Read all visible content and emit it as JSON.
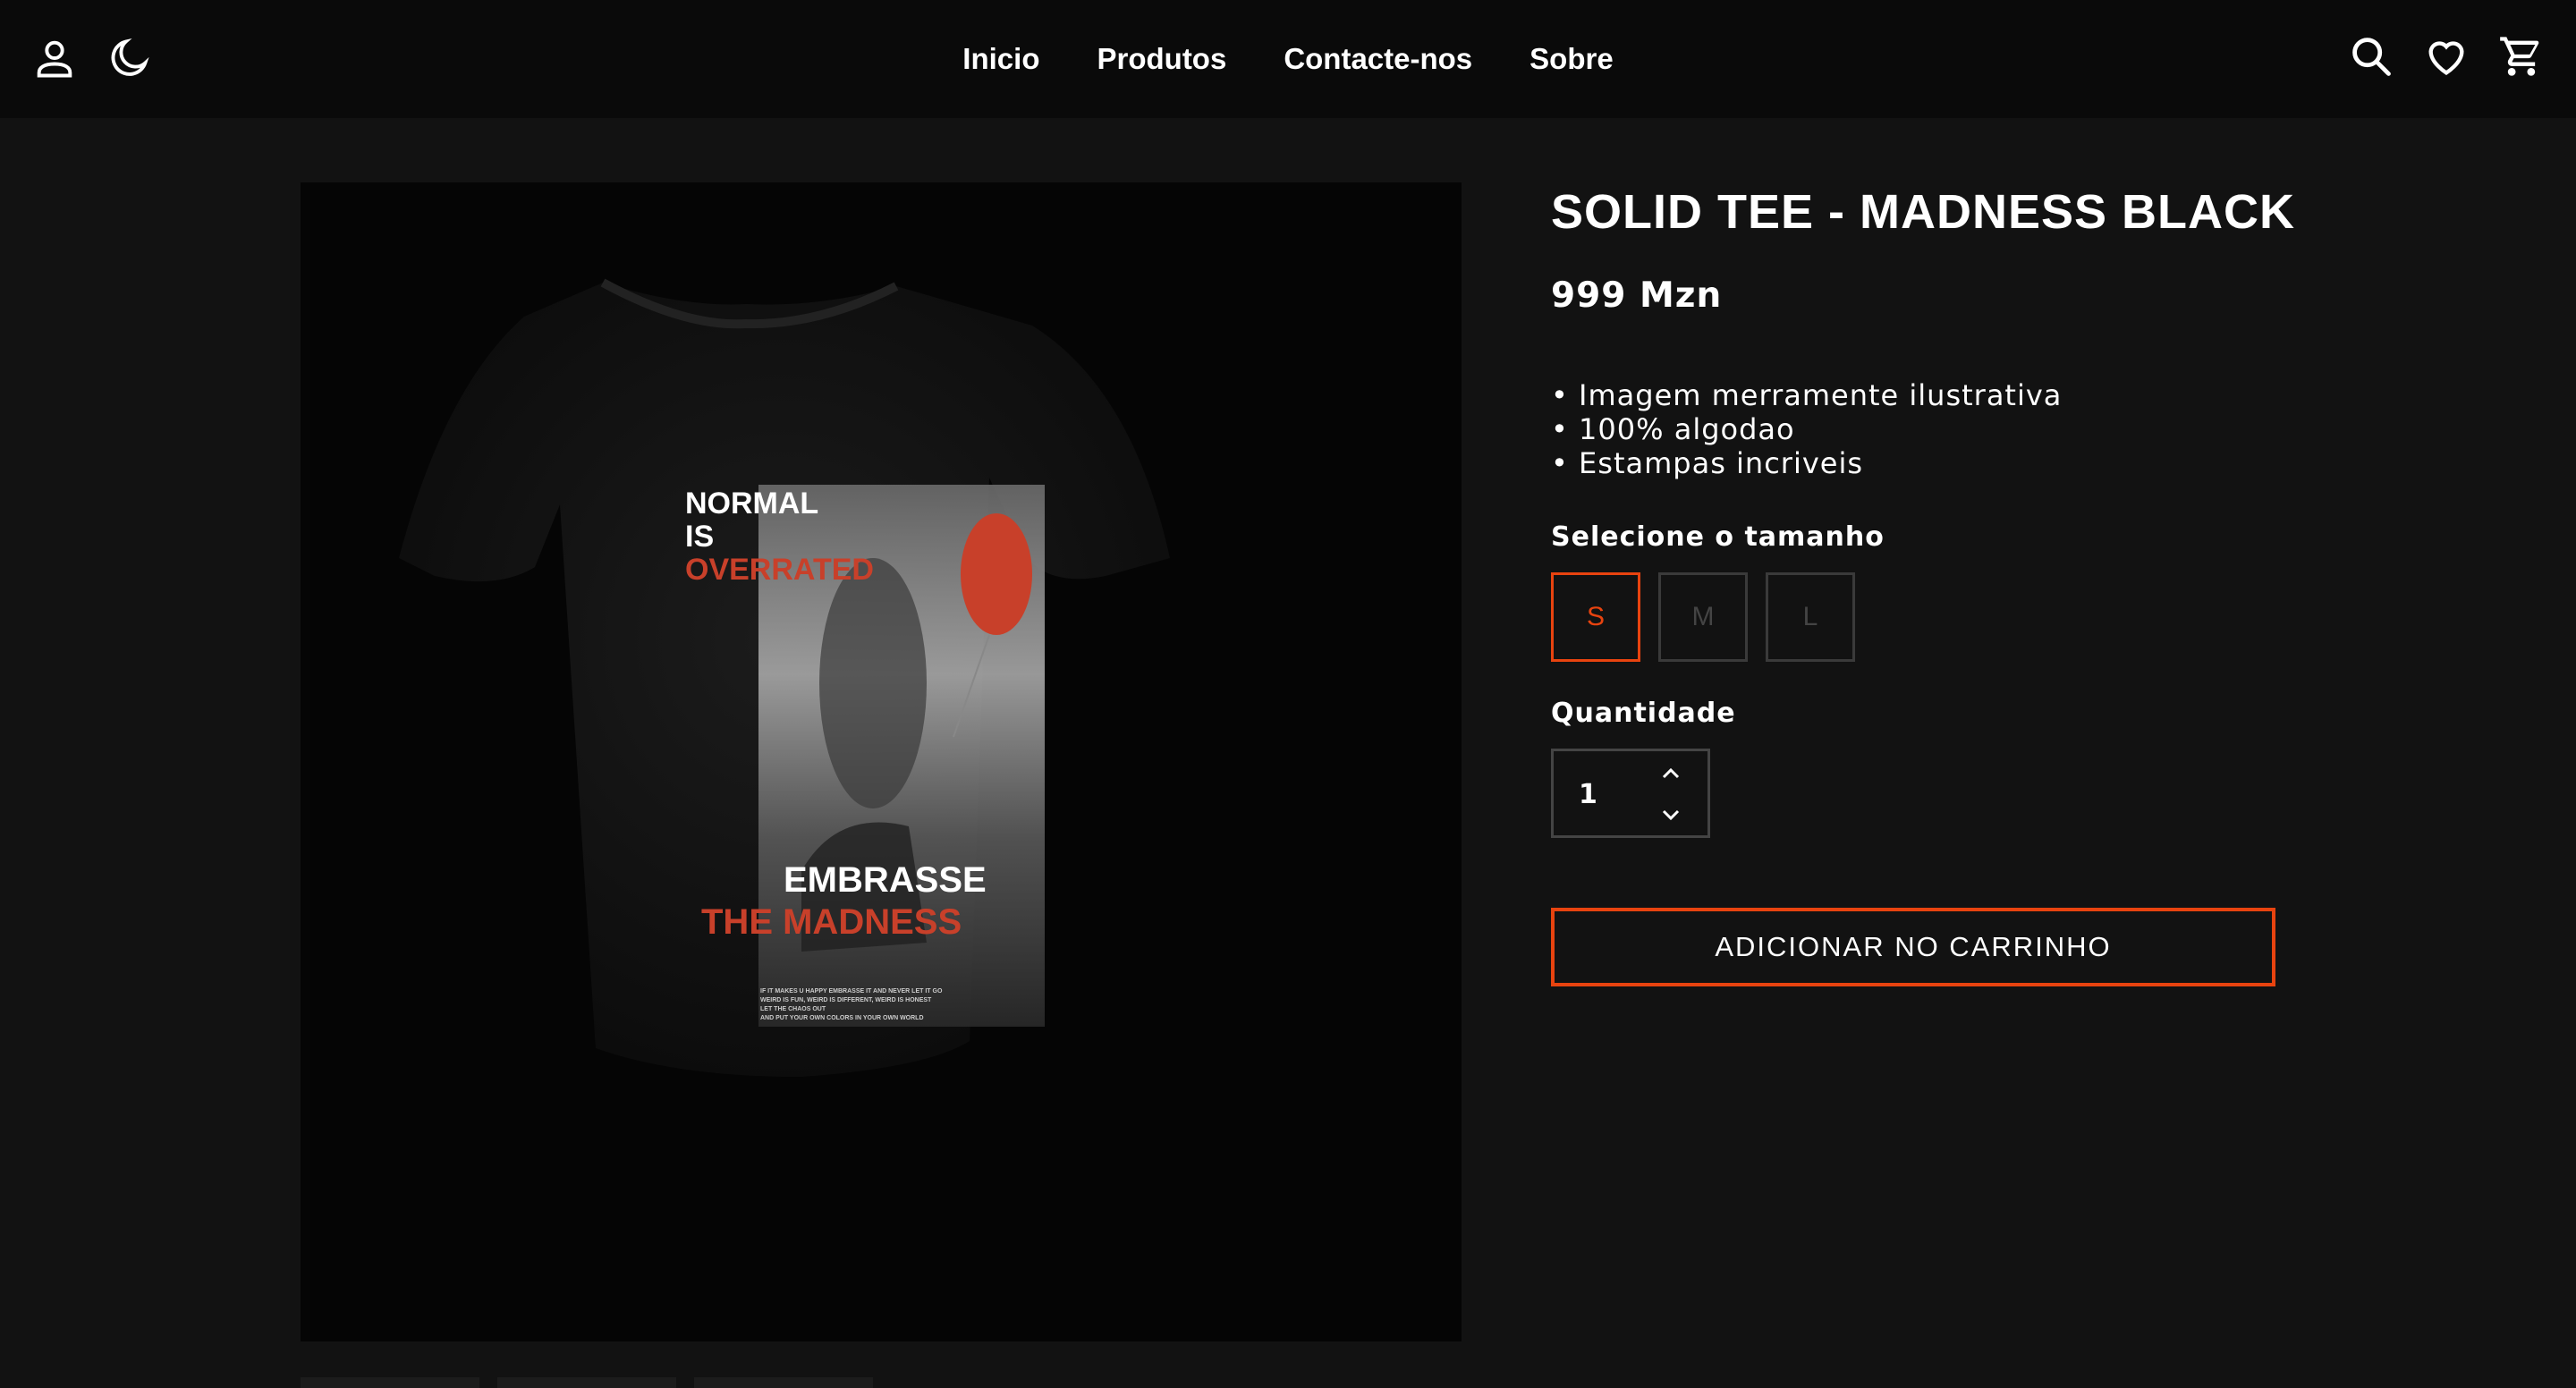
{
  "navbar": {
    "left_icons": [
      "user-icon",
      "moon-icon"
    ],
    "links": [
      "Inicio",
      "Produtos",
      "Contacte-nos",
      "Sobre"
    ],
    "right_icons": [
      "search-icon",
      "heart-icon",
      "cart-icon"
    ]
  },
  "product": {
    "title": "SOLID TEE - MADNESS BLACK",
    "price": "999 Mzn",
    "features": [
      "Imagem merramente ilustrativa",
      "100% algodao",
      "Estampas incriveis"
    ],
    "size_label": "Selecione o tamanho",
    "sizes": [
      "S",
      "M",
      "L"
    ],
    "selected_size": "S",
    "quantity_label": "Quantidade",
    "quantity": "1",
    "add_to_cart": "ADICIONAR NO CARRINHO"
  },
  "shirt_print": {
    "line1": "NORMAL",
    "line2": "IS",
    "line3": "OVERRATED",
    "line4": "EMBRASSE",
    "line5": "THE MADNESS",
    "small_text": [
      "IF IT MAKES U HAPPY EMBRASSE IT AND NEVER LET IT GO",
      "WEIRD IS FUN, WEIRD IS DIFFERENT, WEIRD IS HONEST",
      "LET THE CHAOS OUT",
      "AND PUT YOUR OWN COLORS IN YOUR OWN WORLD"
    ]
  },
  "colors": {
    "accent": "#e8430f",
    "background": "#121212",
    "navbar": "#0a0a0a"
  }
}
